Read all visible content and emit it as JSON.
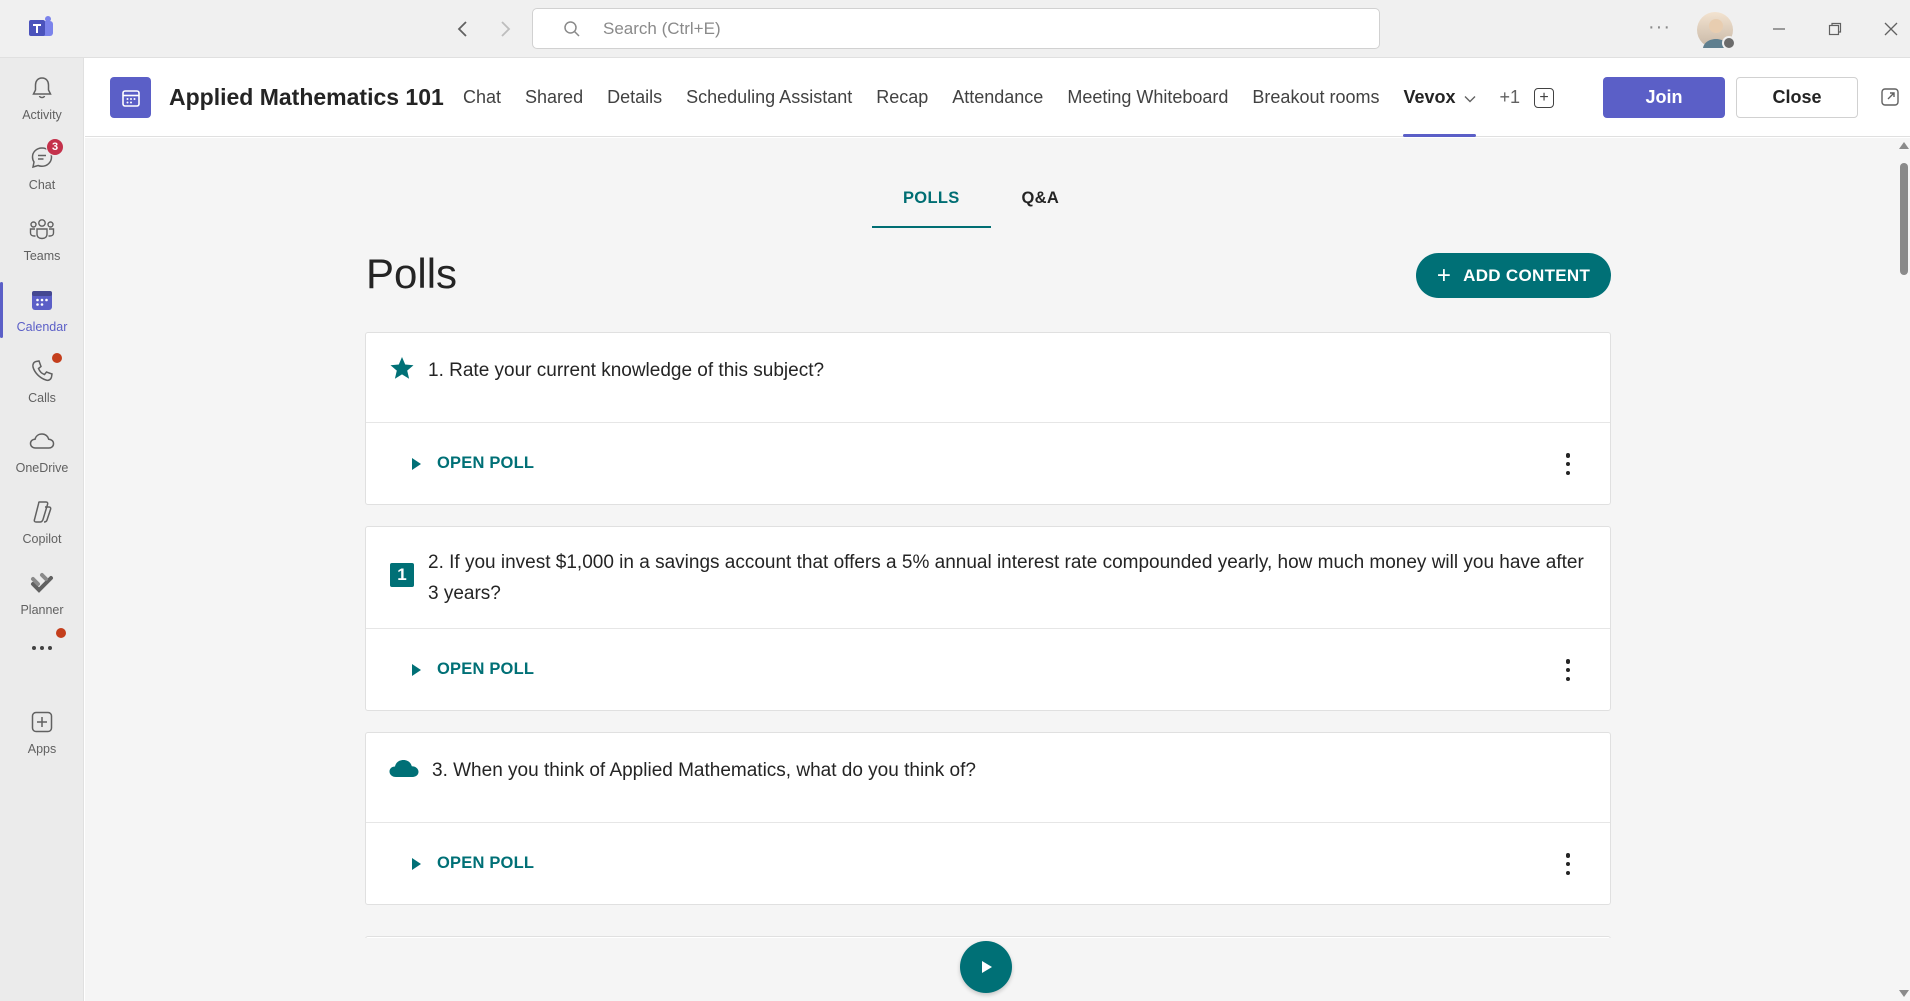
{
  "titlebar": {
    "search_placeholder": "Search (Ctrl+E)"
  },
  "rail": {
    "items": [
      {
        "label": "Activity",
        "icon": "bell-icon"
      },
      {
        "label": "Chat",
        "icon": "chat-icon",
        "badge": "3"
      },
      {
        "label": "Teams",
        "icon": "teams-icon"
      },
      {
        "label": "Calendar",
        "icon": "calendar-icon",
        "active": true
      },
      {
        "label": "Calls",
        "icon": "phone-icon"
      },
      {
        "label": "OneDrive",
        "icon": "cloud-icon"
      },
      {
        "label": "Copilot",
        "icon": "copilot-icon"
      },
      {
        "label": "Planner",
        "icon": "planner-icon"
      },
      {
        "label": "",
        "icon": "more-icon"
      },
      {
        "label": "Apps",
        "icon": "apps-icon"
      }
    ]
  },
  "header": {
    "title": "Applied Mathematics 101",
    "tabs": [
      "Chat",
      "Shared",
      "Details",
      "Scheduling Assistant",
      "Recap",
      "Attendance",
      "Meeting Whiteboard",
      "Breakout rooms"
    ],
    "active_tab": "Vevox",
    "more_tabs": "+1",
    "join_label": "Join",
    "close_label": "Close"
  },
  "vevox": {
    "subtabs": [
      "POLLS",
      "Q&A"
    ],
    "heading": "Polls",
    "add_content_label": "ADD CONTENT",
    "open_poll_label": "OPEN POLL",
    "number_badge": "1",
    "polls": [
      {
        "question": "1. Rate your current knowledge of this subject?",
        "icon": "star-icon"
      },
      {
        "question": "2. If you invest $1,000 in a savings account that offers a 5% annual interest rate compounded yearly, how much money will you have after 3 years?",
        "icon": "number-icon"
      },
      {
        "question": "3. When you think of Applied Mathematics, what do you think of?",
        "icon": "word-cloud-icon"
      }
    ]
  },
  "colors": {
    "teams_accent": "#5b5fc7",
    "vevox_teal": "#007076",
    "badge_red": "#c4314b"
  }
}
